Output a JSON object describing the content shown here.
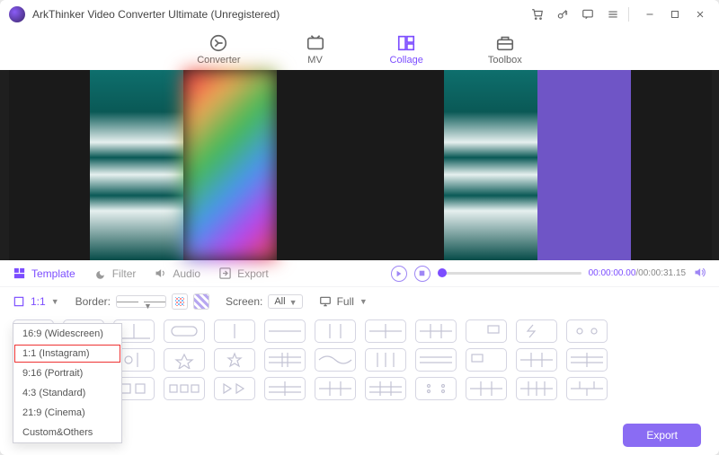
{
  "header": {
    "title": "ArkThinker Video Converter Ultimate (Unregistered)"
  },
  "tabs": [
    {
      "label": "Converter"
    },
    {
      "label": "MV"
    },
    {
      "label": "Collage"
    },
    {
      "label": "Toolbox"
    }
  ],
  "sections": [
    "Template",
    "Filter",
    "Audio",
    "Export"
  ],
  "playback": {
    "current": "00:00:00.00",
    "total": "00:00:31.15"
  },
  "toolbar": {
    "ratio": "1:1",
    "border_label": "Border:",
    "screen_label": "Screen:",
    "screen_value": "All",
    "view_value": "Full"
  },
  "ratio_options": [
    "16:9 (Widescreen)",
    "1:1 (Instagram)",
    "9:16 (Portrait)",
    "4:3 (Standard)",
    "21:9 (Cinema)",
    "Custom&Others"
  ],
  "footer": {
    "export": "Export"
  },
  "template_rows": [
    [
      "blank",
      "diag",
      "lshape",
      "pill",
      "two-h",
      "two-v",
      "three-v",
      "grid4",
      "grid3c",
      "pip",
      "bolt",
      "hearts"
    ],
    [
      "three-h",
      "two-circ",
      "sun",
      "burst",
      "star",
      "cross",
      "wave",
      "four-v",
      "three-h2",
      "pip2",
      "grid6",
      "grid3r"
    ],
    [
      "triple",
      "three-circ",
      "dbl-box",
      "tri-box",
      "dbl-play",
      "grid2x3",
      "grid3x2",
      "grid3x3",
      "dots",
      "grid6b",
      "grid8",
      "brick"
    ]
  ]
}
